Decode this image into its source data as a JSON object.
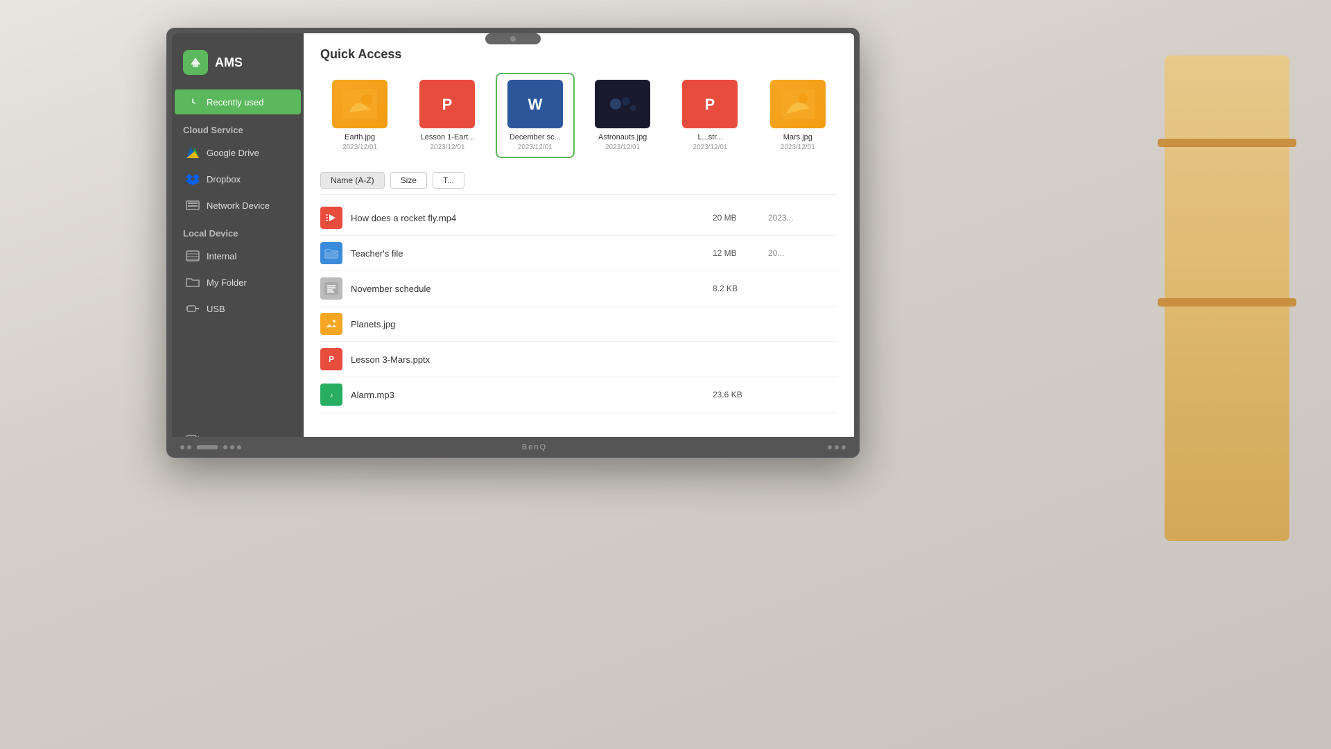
{
  "app": {
    "title": "AMS",
    "quick_access_label": "Quick Access"
  },
  "sidebar": {
    "recently_used_label": "Recently used",
    "cloud_service_label": "Cloud Service",
    "local_device_label": "Local Device",
    "items": [
      {
        "id": "recently-used",
        "label": "Recently used",
        "active": true
      },
      {
        "id": "google-drive",
        "label": "Google Drive",
        "active": false
      },
      {
        "id": "dropbox",
        "label": "Dropbox",
        "active": false
      },
      {
        "id": "network-device",
        "label": "Network Device",
        "active": false
      },
      {
        "id": "internal",
        "label": "Internal",
        "active": false
      },
      {
        "id": "my-folder",
        "label": "My Folder",
        "active": false
      },
      {
        "id": "usb",
        "label": "USB",
        "active": false
      }
    ]
  },
  "thumbnails": [
    {
      "name": "Earth.jpg",
      "date": "2023/12/01",
      "type": "jpg"
    },
    {
      "name": "Lesson 1-Eart...",
      "date": "2023/12/01",
      "type": "pptx"
    },
    {
      "name": "December sc...",
      "date": "2023/12/01",
      "type": "word",
      "selected": true
    },
    {
      "name": "Astronauts.jpg",
      "date": "2023/12/01",
      "type": "astro"
    },
    {
      "name": "L...str...",
      "date": "2023/12/01",
      "type": "pptx2"
    },
    {
      "name": "Mars.jpg",
      "date": "2023/12/01",
      "type": "jpg2"
    }
  ],
  "table": {
    "columns": {
      "name_label": "Name (A-Z)",
      "size_label": "Size",
      "type_label": "T..."
    },
    "rows": [
      {
        "name": "How does a rocket fly.mp4",
        "size": "20 MB",
        "date": "2023...",
        "type": "video"
      },
      {
        "name": "Teacher's file",
        "size": "12 MB",
        "date": "20...",
        "type": "folder"
      },
      {
        "name": "November schedule",
        "size": "8.2 KB",
        "date": "",
        "type": "doc"
      },
      {
        "name": "Planets.jpg",
        "size": "",
        "date": "",
        "type": "jpg"
      },
      {
        "name": "Lesson 3-Mars.pptx",
        "size": "",
        "date": "",
        "type": "pptx"
      },
      {
        "name": "Alarm.mp3",
        "size": "23.6 KB",
        "date": "",
        "type": "mp3"
      }
    ]
  },
  "colors": {
    "sidebar_bg": "#4a4a4a",
    "active_green": "#5cb85c",
    "header_bg": "#fff",
    "border": "#e0e0e0"
  }
}
